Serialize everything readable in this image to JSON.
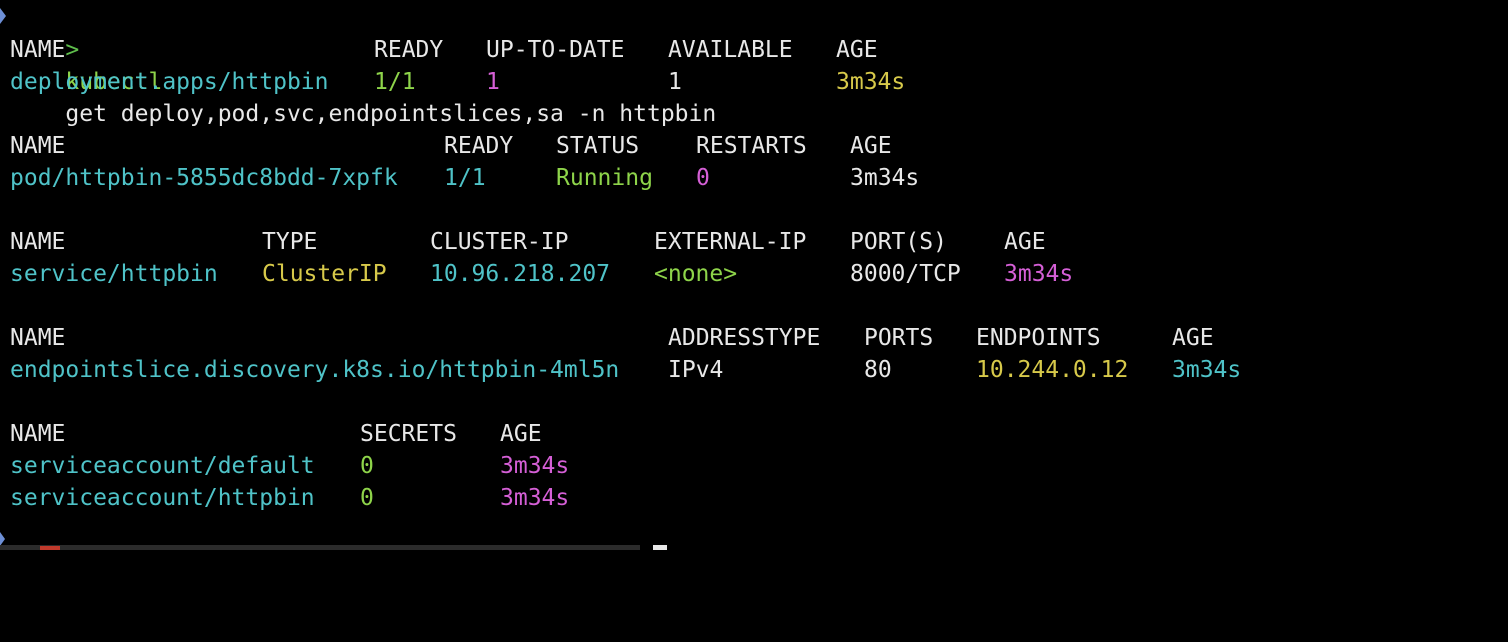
{
  "colors": {
    "cyan": "#4fc3c8",
    "green": "#8ed44a",
    "magenta": "#d55fd6",
    "yellow": "#d7c94a",
    "white": "#e8e8e8"
  },
  "prompt": {
    "arrow": ">",
    "command": "kubectl",
    "args": "get deploy,pod,svc,endpointslices,sa -n httpbin"
  },
  "deployments": {
    "headers": [
      "NAME",
      "READY",
      "UP-TO-DATE",
      "AVAILABLE",
      "AGE"
    ],
    "rows": [
      [
        "deployment.apps/httpbin",
        "1/1",
        "1",
        "1",
        "3m34s"
      ]
    ]
  },
  "pods": {
    "headers": [
      "NAME",
      "READY",
      "STATUS",
      "RESTARTS",
      "AGE"
    ],
    "rows": [
      [
        "pod/httpbin-5855dc8bdd-7xpfk",
        "1/1",
        "Running",
        "0",
        "3m34s"
      ]
    ]
  },
  "services": {
    "headers": [
      "NAME",
      "TYPE",
      "CLUSTER-IP",
      "EXTERNAL-IP",
      "PORT(S)",
      "AGE"
    ],
    "rows": [
      [
        "service/httpbin",
        "ClusterIP",
        "10.96.218.207",
        "<none>",
        "8000/TCP",
        "3m34s"
      ]
    ]
  },
  "endpointslices": {
    "headers": [
      "NAME",
      "ADDRESSTYPE",
      "PORTS",
      "ENDPOINTS",
      "AGE"
    ],
    "rows": [
      [
        "endpointslice.discovery.k8s.io/httpbin-4ml5n",
        "IPv4",
        "80",
        "10.244.0.12",
        "3m34s"
      ]
    ]
  },
  "serviceaccounts": {
    "headers": [
      "NAME",
      "SECRETS",
      "AGE"
    ],
    "rows": [
      [
        "serviceaccount/default",
        "0",
        "3m34s"
      ],
      [
        "serviceaccount/httpbin",
        "0",
        "3m34s"
      ]
    ]
  }
}
